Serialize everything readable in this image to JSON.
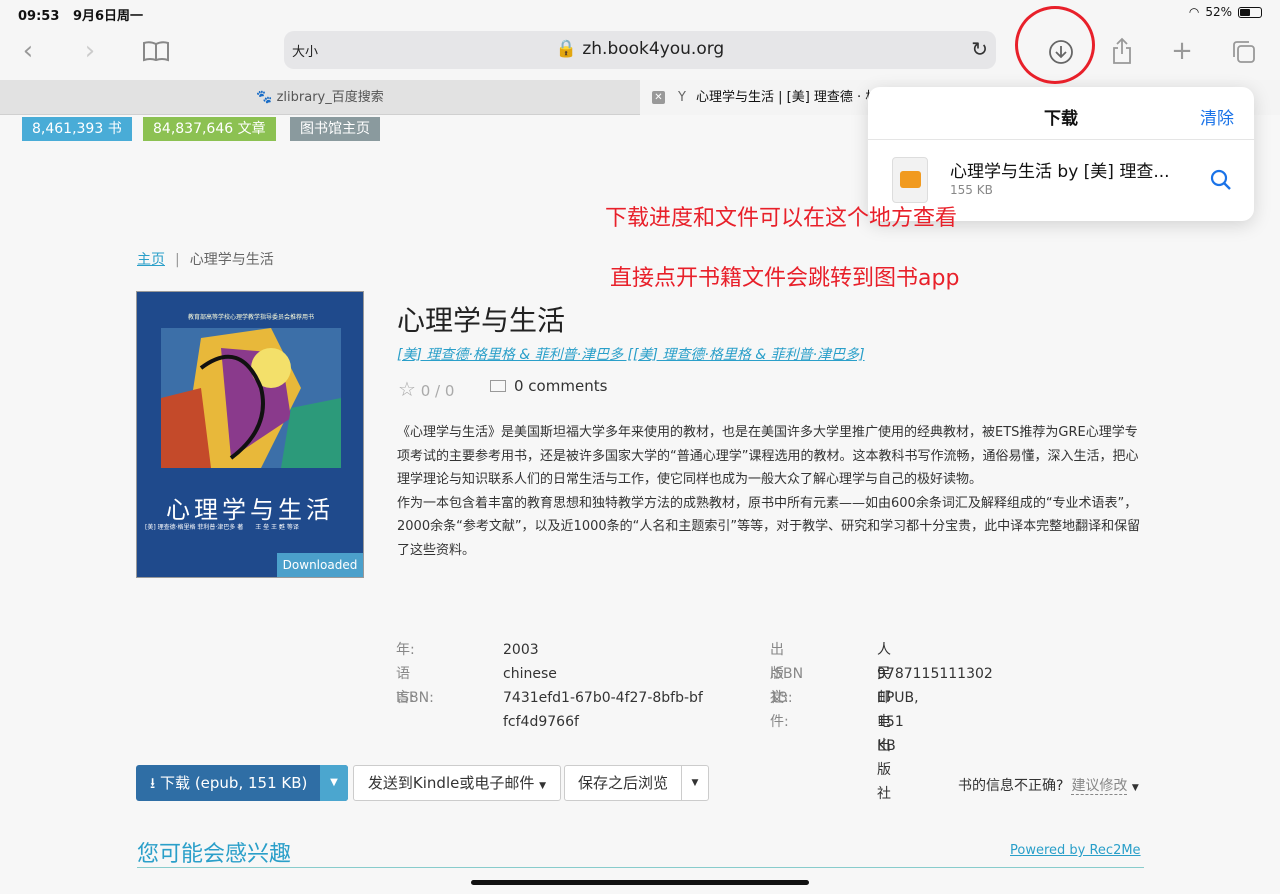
{
  "status": {
    "time": "09:53",
    "date": "9月6日周一",
    "battery": "52%",
    "battery_level": 0.52
  },
  "toolbar": {
    "text_size": "大小",
    "url": "zh.book4you.org"
  },
  "tabs": [
    {
      "label": "zlibrary_百度搜索"
    },
    {
      "label": "心理学与生活 | [美] 理查德 · 格"
    }
  ],
  "stats": [
    {
      "label": "8,461,393 书",
      "color": "#49acd7"
    },
    {
      "label": "84,837,646 文章",
      "color": "#8cc152"
    },
    {
      "label": "图书馆主页",
      "color": "#8a9a9e"
    }
  ],
  "downloads": {
    "title": "下载",
    "clear": "清除",
    "file_name": "心理学与生活 by [美] 理查...",
    "file_size": "155 KB"
  },
  "annotations": [
    "下载进度和文件可以在这个地方查看",
    "直接点开书籍文件会跳转到图书app"
  ],
  "breadcrumb": {
    "home": "主页",
    "separator": "|",
    "current": "心理学与生活"
  },
  "cover": {
    "series": "教育部高等学校心理学教学指导委员会推荐用书",
    "title": "心理学与生活",
    "authors": "[美] 理查德·格里格 菲利普·津巴多 著　　王 垒 王 甦 等译",
    "downloaded": "Downloaded"
  },
  "book": {
    "title": "心理学与生活",
    "author": "[美] 理查德·格里格 & 菲利普·津巴多 [[美] 理查德·格里格 & 菲利普·津巴多]",
    "rating": "0 / 0",
    "comments": "0 comments",
    "description_1": "《心理学与生活》是美国斯坦福大学多年来使用的教材，也是在美国许多大学里推广使用的经典教材，被ETS推荐为GRE心理学专项考试的主要参考用书，还是被许多国家大学的“普通心理学”课程选用的教材。这本教科书写作流畅，通俗易懂，深入生活，把心理学理论与知识联系人们的日常生活与工作，使它同样也成为一般大众了解心理学与自己的极好读物。",
    "description_2": "作为一本包含着丰富的教育思想和独特教学方法的成熟教材，原书中所有元素——如由600余条词汇及解释组成的“专业术语表”，2000余条“参考文献”，以及近1000条的“人名和主题索引”等等，对于教学、研究和学习都十分宝贵，此中译本完整地翻译和保留了这些资料。"
  },
  "properties": {
    "year_label": "年:",
    "year": "2003",
    "language_label": "语言:",
    "language": "chinese",
    "isbn_label": "ISBN:",
    "isbn": "7431efd1-67b0-4f27-8bfb-bffcf4d9766f",
    "publisher_label": "出版社:",
    "publisher": "人民邮电出版社",
    "isbn13_label": "ISBN 13:",
    "isbn13": "9787115111302",
    "file_label": "文件:",
    "file": "EPUB, 151 KB"
  },
  "actions": {
    "download": "下载 (epub, 151 KB)",
    "send_kindle": "发送到Kindle或电子邮件",
    "save_later": "保存之后浏览",
    "incorrect": "书的信息不正确?",
    "suggest": "建议修改"
  },
  "recommend": {
    "title": "您可能会感兴趣",
    "powered": "Powered by Rec2Me"
  }
}
